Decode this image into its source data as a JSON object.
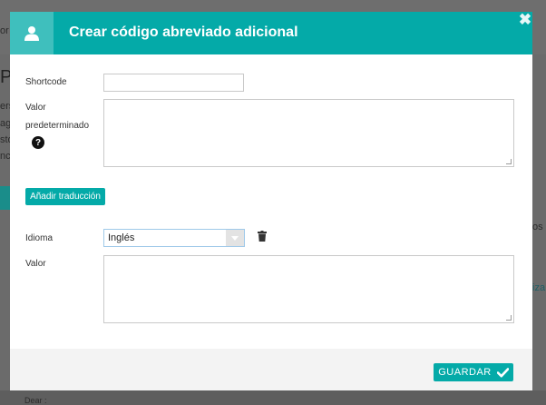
{
  "background": {
    "fragments": [
      "or",
      "PE",
      "ers",
      "ag",
      "sto",
      "nci",
      "os",
      "iza",
      "Dear :"
    ]
  },
  "modal": {
    "title": "Crear código abreviado adicional",
    "close_symbol": "✖",
    "header_icon": "user-icon",
    "shortcode": {
      "label": "Shortcode",
      "value": ""
    },
    "default_value": {
      "label_line1": "Valor",
      "label_line2": "predeterminado",
      "help_symbol": "?",
      "value": ""
    },
    "add_translation_label": "Añadir traducción",
    "language": {
      "label": "Idioma",
      "selected": "Inglés"
    },
    "value": {
      "label": "Valor",
      "value": ""
    },
    "save_label": "GUARDAR"
  },
  "colors": {
    "accent": "#04aaa8",
    "header_icon_bg": "#3fbfbd"
  }
}
